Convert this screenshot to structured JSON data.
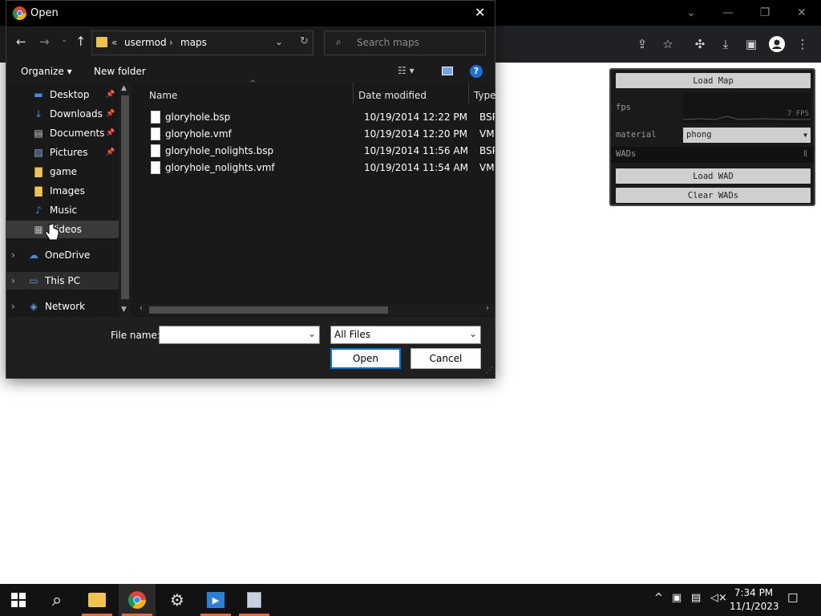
{
  "dialog": {
    "title": "Open",
    "close_glyph": "✕",
    "breadcrumb": {
      "root": "«",
      "folder1": "usermod",
      "folder2": "maps"
    },
    "search_placeholder": "Search maps",
    "organize_label": "Organize ▾",
    "new_folder_label": "New folder",
    "help_glyph": "?",
    "nav_items": [
      {
        "label": "Desktop",
        "icon": "desktop-icon",
        "pinned": true
      },
      {
        "label": "Downloads",
        "icon": "download-icon",
        "pinned": true
      },
      {
        "label": "Documents",
        "icon": "documents-icon",
        "pinned": true
      },
      {
        "label": "Pictures",
        "icon": "pictures-icon",
        "pinned": true
      },
      {
        "label": "game",
        "icon": "folder-icon",
        "pinned": false
      },
      {
        "label": "Images",
        "icon": "folder-icon",
        "pinned": false
      },
      {
        "label": "Music",
        "icon": "music-icon",
        "pinned": false
      },
      {
        "label": "Videos",
        "icon": "videos-icon",
        "pinned": false
      },
      {
        "label": "OneDrive",
        "icon": "onedrive-icon",
        "pinned": false
      },
      {
        "label": "This PC",
        "icon": "this-pc-icon",
        "pinned": false
      },
      {
        "label": "Network",
        "icon": "network-icon",
        "pinned": false
      }
    ],
    "columns": {
      "name": "Name",
      "date": "Date modified",
      "type": "Type"
    },
    "files": [
      {
        "name": "gloryhole.bsp",
        "date": "10/19/2014 12:22 PM",
        "type": "BSP F"
      },
      {
        "name": "gloryhole.vmf",
        "date": "10/19/2014 12:20 PM",
        "type": "VMF"
      },
      {
        "name": "gloryhole_nolights.bsp",
        "date": "10/19/2014 11:56 AM",
        "type": "BSP F"
      },
      {
        "name": "gloryhole_nolights.vmf",
        "date": "10/19/2014 11:54 AM",
        "type": "VMF"
      }
    ],
    "filename_label": "File name:",
    "filename_value": "",
    "filetype_value": "All Files",
    "open_label": "Open",
    "cancel_label": "Cancel"
  },
  "gui_panel": {
    "load_map": "Load Map",
    "fps_label": "fps",
    "fps_value": "7 FPS",
    "material_label": "material",
    "material_value": "phong",
    "wads_label": "WADs",
    "load_wad": "Load WAD",
    "clear_wads": "Clear WADs"
  },
  "taskbar": {
    "time": "7:34 PM",
    "date": "11/1/2023"
  },
  "colors": {
    "accent": "#0078d4",
    "taskbar_underline": "#e06a3c",
    "dialog_bg": "#202020"
  }
}
